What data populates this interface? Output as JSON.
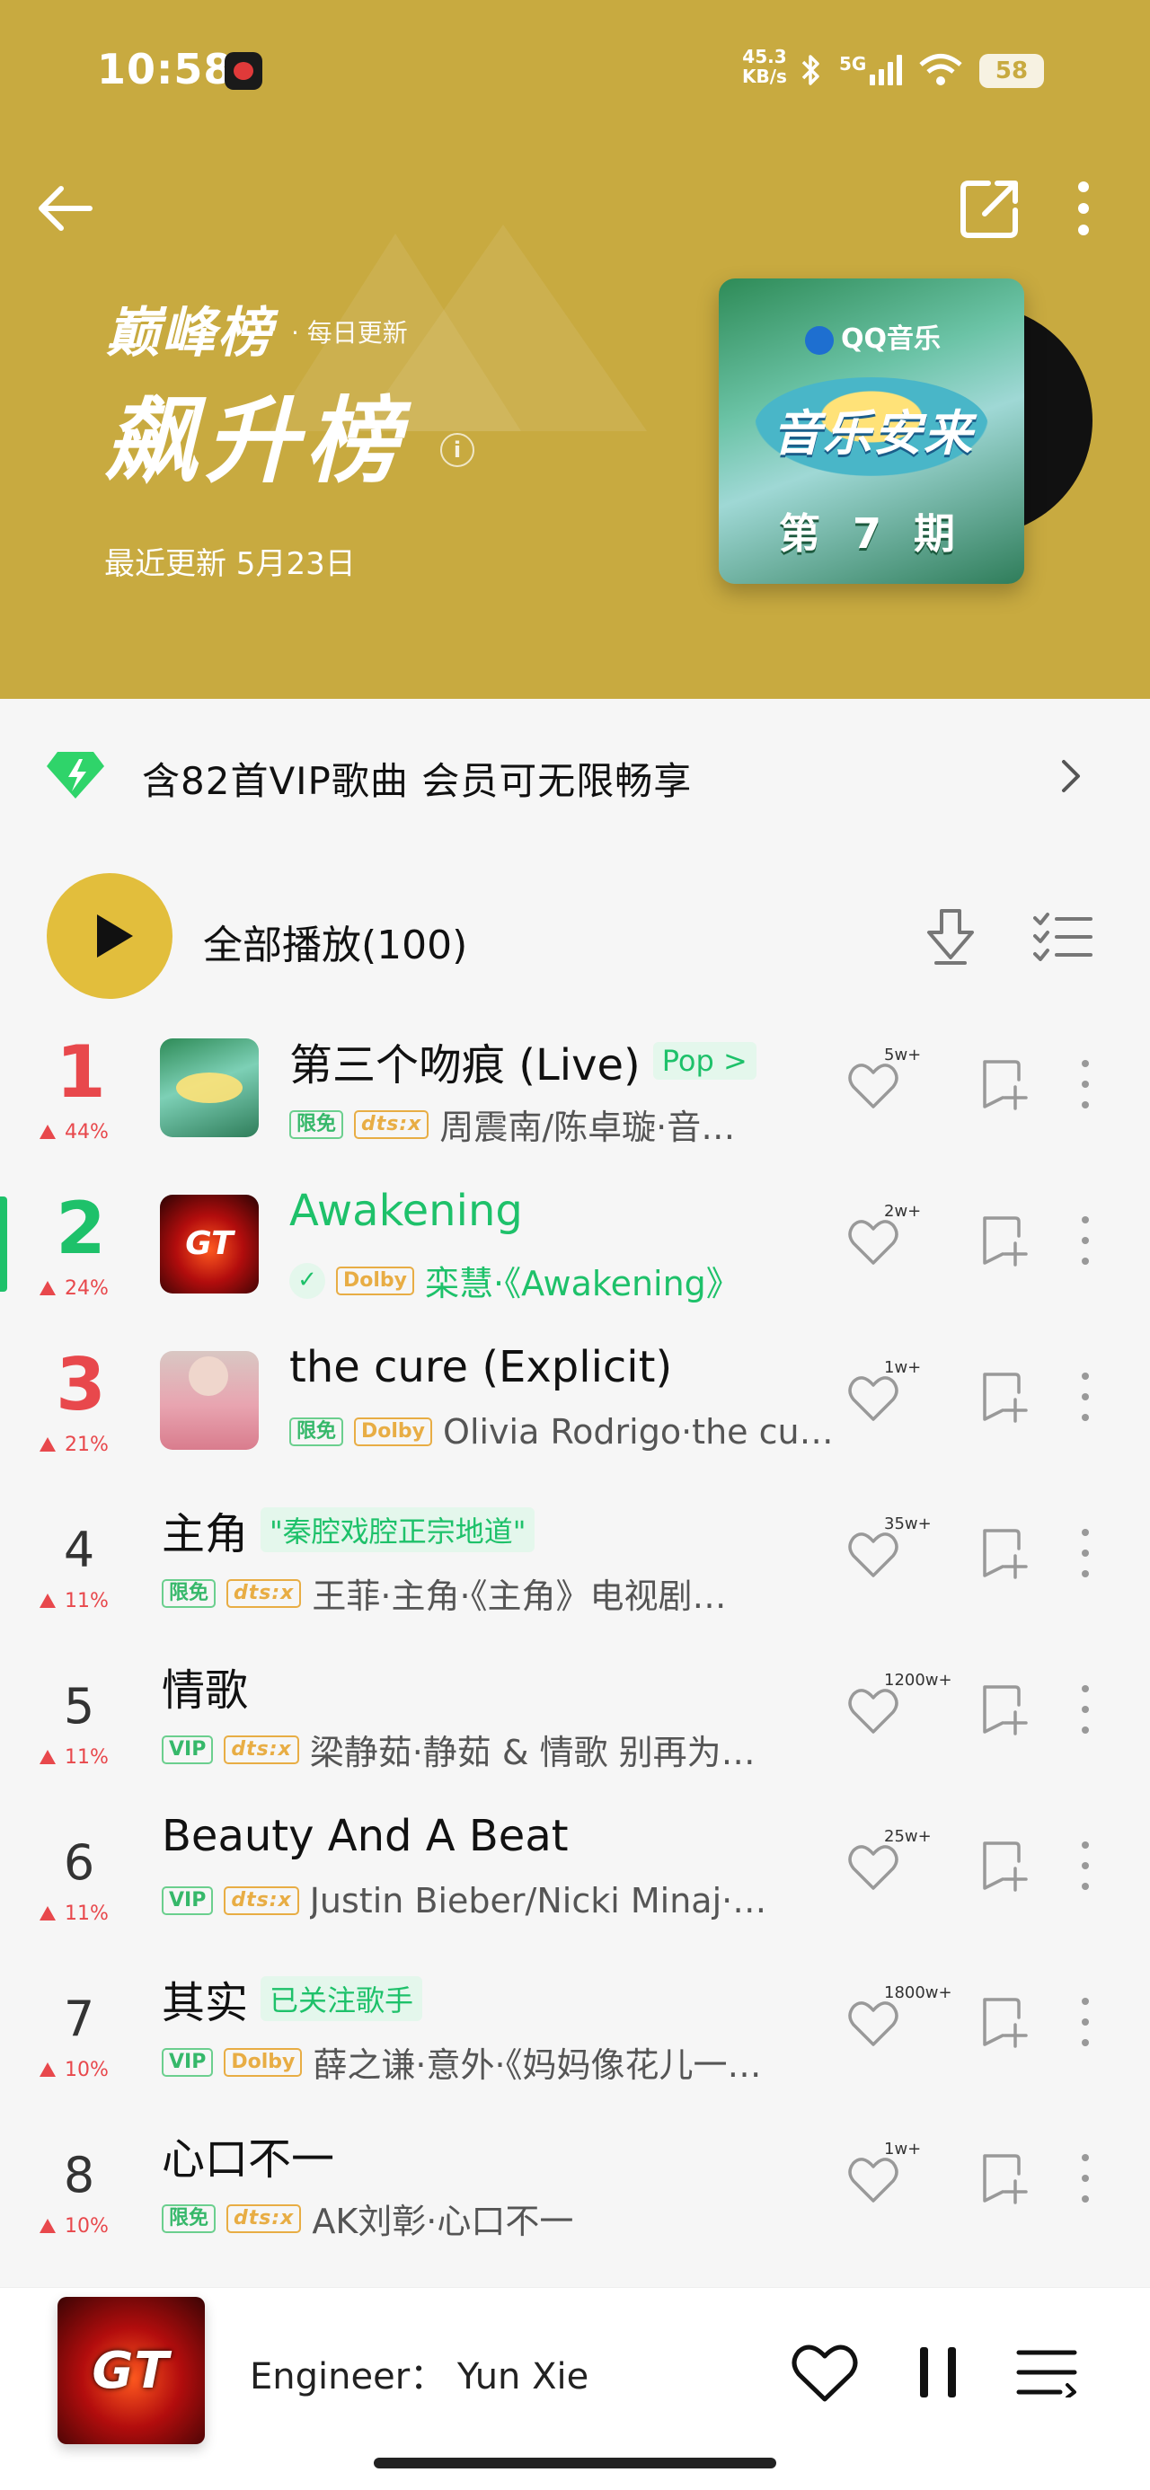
{
  "status_bar": {
    "time": "10:58",
    "net_speed_value": "45.3",
    "net_speed_unit": "KB/s",
    "network": "5G",
    "battery": "58"
  },
  "header": {
    "brand": "巅峰榜",
    "brand_sub": "· 每日更新",
    "title": "飙升榜",
    "updated": "最近更新 5月23日",
    "cover_logo": "QQ音乐",
    "cover_show": "音乐安来",
    "cover_episode": "第 7 期",
    "bg_color": "#c8aa40"
  },
  "vip_banner": {
    "text": "含82首VIP歌曲 会员可无限畅享",
    "icon": "diamond-icon"
  },
  "play_all": {
    "label": "全部播放(100)"
  },
  "songs": [
    {
      "rank": "1",
      "change": "44%",
      "title": "第三个吻痕 (Live)",
      "tag": "Pop >",
      "badges": [
        "限免",
        "dts:x"
      ],
      "meta": "周震南/陈卓璇·音…",
      "likes": "5w+"
    },
    {
      "rank": "2",
      "change": "24%",
      "title": "Awakening",
      "tag": "",
      "badges": [
        "✓",
        "Dolby"
      ],
      "meta": "栾慧·《Awakening》",
      "likes": "2w+"
    },
    {
      "rank": "3",
      "change": "21%",
      "title": "the cure (Explicit)",
      "tag": "",
      "badges": [
        "限免",
        "Dolby"
      ],
      "meta": "Olivia Rodrigo·the cu…",
      "likes": "1w+"
    },
    {
      "rank": "4",
      "change": "11%",
      "title": "主角",
      "tag": "\"秦腔戏腔正宗地道\"",
      "badges": [
        "限免",
        "dts:x"
      ],
      "meta": "王菲·主角·《主角》电视剧…",
      "likes": "35w+"
    },
    {
      "rank": "5",
      "change": "11%",
      "title": "情歌",
      "tag": "",
      "badges": [
        "VIP",
        "dts:x"
      ],
      "meta": "梁静茹·静茹 & 情歌 别再为…",
      "likes": "1200w+"
    },
    {
      "rank": "6",
      "change": "11%",
      "title": "Beauty And A Beat",
      "tag": "",
      "badges": [
        "VIP",
        "dts:x"
      ],
      "meta": "Justin Bieber/Nicki Minaj·…",
      "likes": "25w+"
    },
    {
      "rank": "7",
      "change": "10%",
      "title": "其实",
      "tag": "已关注歌手",
      "badges": [
        "VIP",
        "Dolby"
      ],
      "meta": "薛之谦·意外·《妈妈像花儿一…",
      "likes": "1800w+"
    },
    {
      "rank": "8",
      "change": "10%",
      "title": "心口不一",
      "tag": "",
      "badges": [
        "限免",
        "dts:x"
      ],
      "meta": "AK刘彰·心口不一",
      "likes": "1w+"
    }
  ],
  "player": {
    "now_playing": "Engineer： Yun Xie",
    "cover_text": "GT"
  },
  "colors": {
    "rank_top": "#e8484c",
    "rank_two": "#1ec16a",
    "accent_green": "#1ec16a",
    "play_button": "#e2be3c"
  }
}
